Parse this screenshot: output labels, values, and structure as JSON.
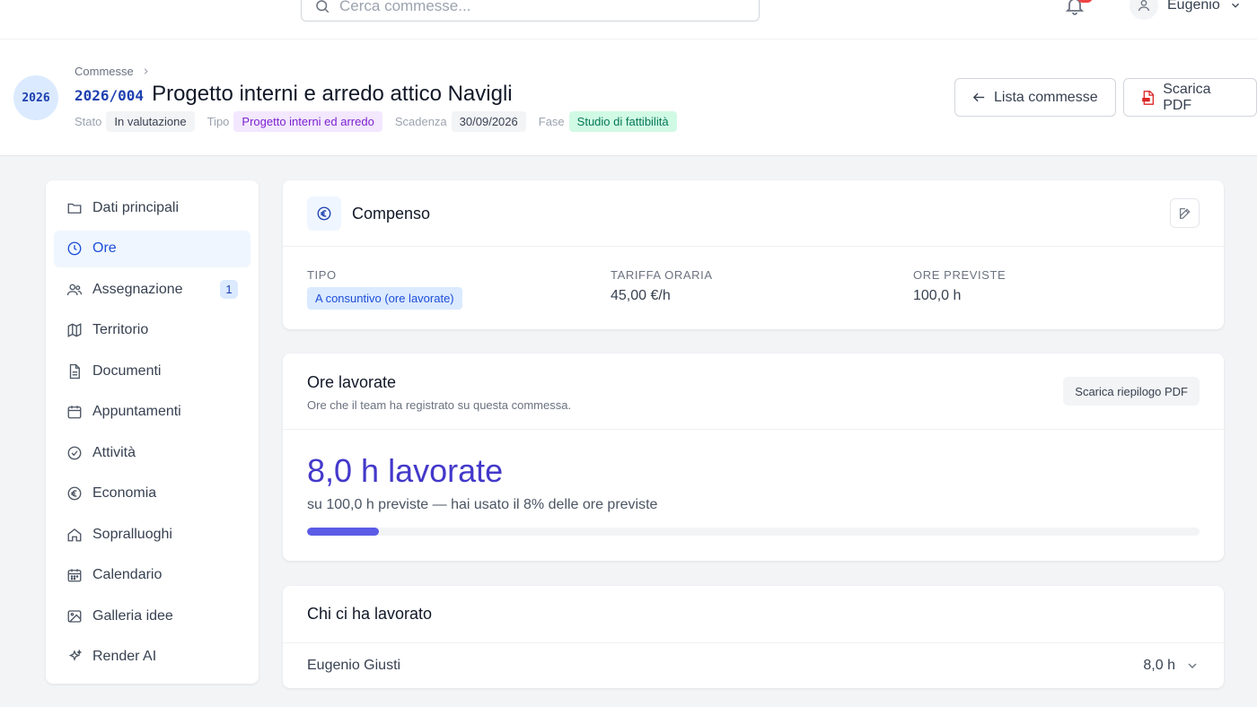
{
  "topbar": {
    "search_placeholder": "Cerca commesse...",
    "user_name": "Eugenio"
  },
  "header": {
    "breadcrumb": "Commesse",
    "year": "2026",
    "code": "2026/004",
    "title": "Progetto interni e arredo attico Navigli",
    "meta": {
      "stato_label": "Stato",
      "stato_value": "In valutazione",
      "tipo_label": "Tipo",
      "tipo_value": "Progetto interni ed arredo",
      "scadenza_label": "Scadenza",
      "scadenza_value": "30/09/2026",
      "fase_label": "Fase",
      "fase_value": "Studio di fattibilità"
    },
    "btn_list": "Lista commesse",
    "btn_pdf": "Scarica PDF"
  },
  "sidebar": {
    "items": [
      {
        "label": "Dati principali",
        "icon": "folder-icon"
      },
      {
        "label": "Ore",
        "icon": "clock-icon",
        "active": true
      },
      {
        "label": "Assegnazione",
        "icon": "users-icon",
        "count": "1"
      },
      {
        "label": "Territorio",
        "icon": "map-icon"
      },
      {
        "label": "Documenti",
        "icon": "document-icon"
      },
      {
        "label": "Appuntamenti",
        "icon": "calendar-icon"
      },
      {
        "label": "Attività",
        "icon": "check-circle-icon"
      },
      {
        "label": "Economia",
        "icon": "euro-icon"
      },
      {
        "label": "Sopralluoghi",
        "icon": "home-icon"
      },
      {
        "label": "Calendario",
        "icon": "calendar-grid-icon"
      },
      {
        "label": "Galleria idee",
        "icon": "image-icon"
      },
      {
        "label": "Render AI",
        "icon": "sparkles-icon"
      }
    ]
  },
  "compenso": {
    "title": "Compenso",
    "tipo_label": "TIPO",
    "tipo_value": "A consuntivo (ore lavorate)",
    "tariffa_label": "TARIFFA ORARIA",
    "tariffa_value": "45,00 €/h",
    "ore_label": "ORE PREVISTE",
    "ore_value": "100,0 h"
  },
  "ore_lavorate": {
    "title": "Ore lavorate",
    "subtitle": "Ore che il team ha registrato su questa commessa.",
    "btn_pdf": "Scarica riepilogo PDF",
    "hours_text": "8,0 h lavorate",
    "usage_text": "su 100,0 h previste — hai usato il 8% delle ore previste",
    "progress_fraction": 0.08
  },
  "chi_ha_lavorato": {
    "title": "Chi ci ha lavorato",
    "rows": [
      {
        "name": "Eugenio Giusti",
        "hours": "8,0 h"
      }
    ]
  },
  "colors": {
    "accent": "#4338ca",
    "progress": "#5b5ce6",
    "code_blue": "#1e40af",
    "notification": "#ef4444"
  }
}
